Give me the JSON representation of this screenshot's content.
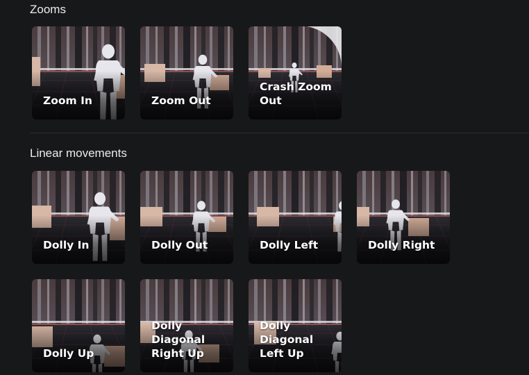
{
  "sections": [
    {
      "title": "Zooms",
      "items": [
        {
          "label": "Zoom In"
        },
        {
          "label": "Zoom Out"
        },
        {
          "label": "Crash Zoom Out"
        }
      ]
    },
    {
      "title": "Linear movements",
      "items": [
        {
          "label": "Dolly In"
        },
        {
          "label": "Dolly Out"
        },
        {
          "label": "Dolly Left"
        },
        {
          "label": "Dolly Right"
        },
        {
          "label": "Dolly Up"
        },
        {
          "label": "Dolly Diagonal Right Up"
        },
        {
          "label": "Dolly Diagonal Left Up"
        }
      ]
    }
  ]
}
